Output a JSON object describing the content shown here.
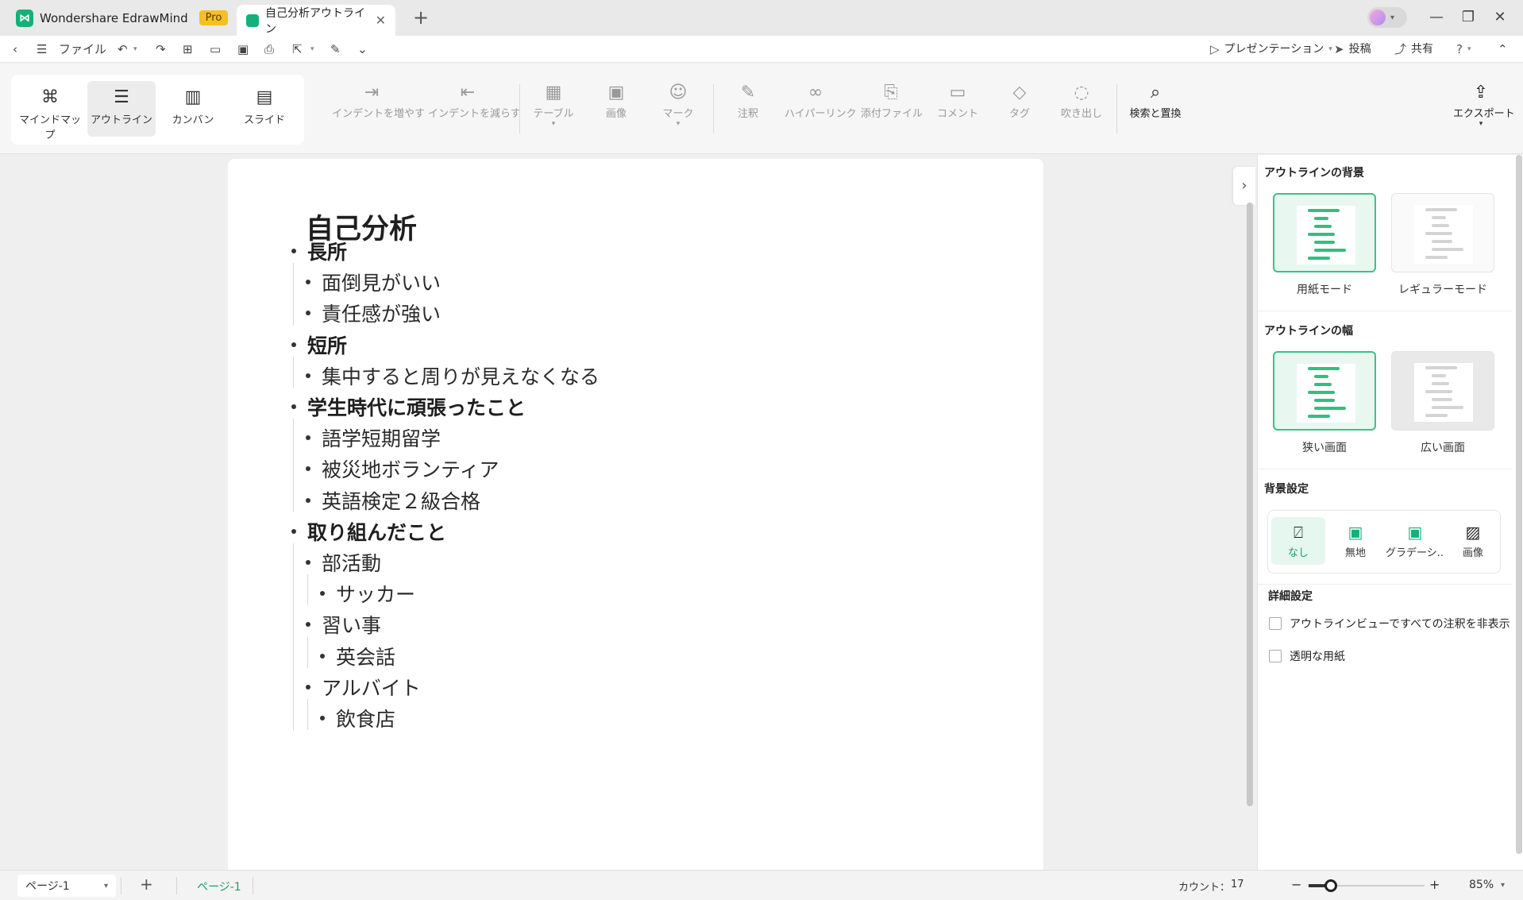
{
  "titlebar": {
    "app_name": "Wondershare EdrawMind",
    "pro_badge": "Pro",
    "doc_tab": "自己分析アウトライン",
    "close_glyph": "✕",
    "new_tab_glyph": "+",
    "window_controls": [
      "—",
      "❐",
      "✕"
    ]
  },
  "menubar": {
    "file": "ファイル",
    "presentation": "プレゼンテーション",
    "post": "投稿",
    "share": "共有"
  },
  "ribbon": {
    "views": [
      {
        "label": "マインドマップ",
        "icon": "mindmap-icon",
        "glyph": "⌘"
      },
      {
        "label": "アウトライン",
        "icon": "outline-icon",
        "glyph": "☰"
      },
      {
        "label": "カンバン",
        "icon": "kanban-icon",
        "glyph": "▥"
      },
      {
        "label": "スライド",
        "icon": "slide-icon",
        "glyph": "▤"
      }
    ],
    "tools": [
      {
        "label": "インデントを増やす",
        "icon": "indent-increase-icon",
        "glyph": "⇥"
      },
      {
        "label": "インデントを減らす",
        "icon": "indent-decrease-icon",
        "glyph": "⇤"
      },
      {
        "label": "テーブル",
        "icon": "table-icon",
        "glyph": "▦"
      },
      {
        "label": "画像",
        "icon": "image-icon",
        "glyph": "▣"
      },
      {
        "label": "マーク",
        "icon": "mark-icon",
        "glyph": "☺"
      },
      {
        "label": "注釈",
        "icon": "note-icon",
        "glyph": "✎"
      },
      {
        "label": "ハイパーリンク",
        "icon": "hyperlink-icon",
        "glyph": "∞"
      },
      {
        "label": "添付ファイル",
        "icon": "attachment-icon",
        "glyph": "⎘"
      },
      {
        "label": "コメント",
        "icon": "comment-icon",
        "glyph": "▭"
      },
      {
        "label": "タグ",
        "icon": "tag-icon",
        "glyph": "◇"
      },
      {
        "label": "吹き出し",
        "icon": "callout-icon",
        "glyph": "◌"
      },
      {
        "label": "検索と置換",
        "icon": "search-replace-icon",
        "glyph": "⌕"
      },
      {
        "label": "エクスポート",
        "icon": "export-icon",
        "glyph": "⇪"
      }
    ]
  },
  "outline": {
    "title": "自己分析",
    "items": [
      {
        "text": "長所",
        "level": 1
      },
      {
        "text": "面倒見がいい",
        "level": 2
      },
      {
        "text": "責任感が強い",
        "level": 2
      },
      {
        "text": "短所",
        "level": 1
      },
      {
        "text": "集中すると周りが見えなくなる",
        "level": 2
      },
      {
        "text": "学生時代に頑張ったこと",
        "level": 1
      },
      {
        "text": "語学短期留学",
        "level": 2
      },
      {
        "text": "被災地ボランティア",
        "level": 2
      },
      {
        "text": "英語検定２級合格",
        "level": 2
      },
      {
        "text": "取り組んだこと",
        "level": 1
      },
      {
        "text": "部活動",
        "level": 2
      },
      {
        "text": "サッカー",
        "level": 3
      },
      {
        "text": "習い事",
        "level": 2
      },
      {
        "text": "英会話",
        "level": 3
      },
      {
        "text": "アルバイト",
        "level": 2
      },
      {
        "text": "飲食店",
        "level": 3
      }
    ]
  },
  "panel": {
    "bg_heading": "アウトラインの背景",
    "paper_mode": "用紙モード",
    "regular_mode": "レギュラーモード",
    "width_heading": "アウトラインの幅",
    "narrow": "狭い画面",
    "wide": "広い画面",
    "bg_settings": "背景設定",
    "bg_options": [
      {
        "label": "なし",
        "icon": "no-background-icon",
        "glyph": "⍁"
      },
      {
        "label": "無地",
        "icon": "solid-color-icon",
        "glyph": "▣"
      },
      {
        "label": "グラデーシ...",
        "icon": "gradient-icon",
        "glyph": "▣"
      },
      {
        "label": "画像",
        "icon": "background-image-icon",
        "glyph": "▨"
      }
    ],
    "advanced_heading": "詳細設定",
    "hide_notes": "アウトラインビューですべての注釈を非表示",
    "transparent_paper": "透明な用紙"
  },
  "status": {
    "page_select": "ページ-1",
    "page_tab": "ページ-1",
    "count_label": "カウント：",
    "count_value": "17",
    "zoom_percent": "85%",
    "zoom_level": 0.19
  },
  "colors": {
    "accent": "#14b07a",
    "pro": "#f5c023",
    "selected_border": "#3cc08a"
  }
}
